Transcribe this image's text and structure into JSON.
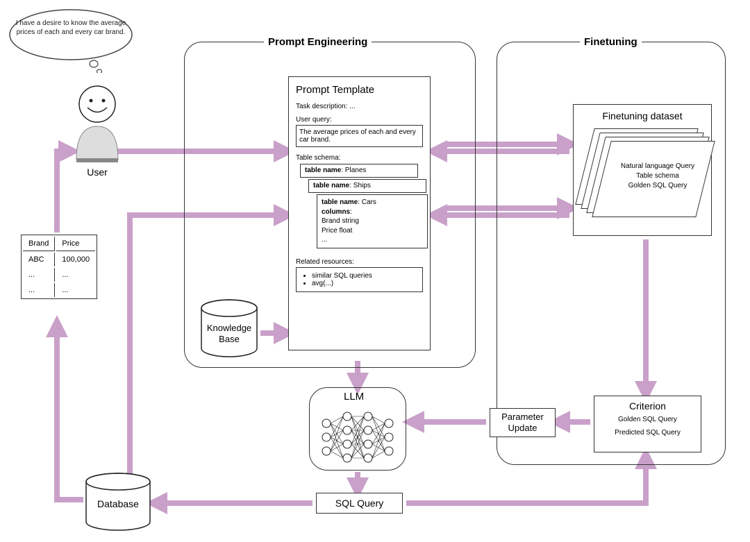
{
  "user": {
    "speech": "I have a desire to know the average prices of each and every car brand.",
    "label": "User"
  },
  "prompt_eng": {
    "title": "Prompt Engineering",
    "template": {
      "title": "Prompt Template",
      "task_label": "Task description: ...",
      "user_query_label": "User query:",
      "user_query": "The average prices of each and every car brand.",
      "schema_label": "Table schema:",
      "tables": {
        "planes_label": "table name",
        "planes_name": ": Planes",
        "ships_label": "table name",
        "ships_name": ": Ships",
        "cars_label": "table name",
        "cars_name": ": Cars",
        "columns_label": "columns",
        "columns_colon": ":",
        "col1": "Brand string",
        "col2": "Price float",
        "col_more": "..."
      },
      "related_label": "Related resources:",
      "related_1": "similar SQL queries",
      "related_2": "avg(...)"
    },
    "knowledge_base": "Knowledge Base"
  },
  "finetuning": {
    "title": "Finetuning",
    "dataset_title": "Finetuning dataset",
    "card_line1": "Natural language Query",
    "card_line2": "Table schema",
    "card_line3": "Golden SQL Query",
    "criterion": {
      "title": "Criterion",
      "line1": "Golden SQL Query",
      "line2": "Predicted SQL Query"
    },
    "param_update": "Parameter Update"
  },
  "llm": {
    "title": "LLM"
  },
  "sql_query": "SQL Query",
  "database": "Database",
  "result_table": {
    "headers": [
      "Brand",
      "Price"
    ],
    "rows": [
      [
        "ABC",
        "100,000"
      ],
      [
        "...",
        "..."
      ],
      [
        "...",
        "..."
      ]
    ]
  }
}
